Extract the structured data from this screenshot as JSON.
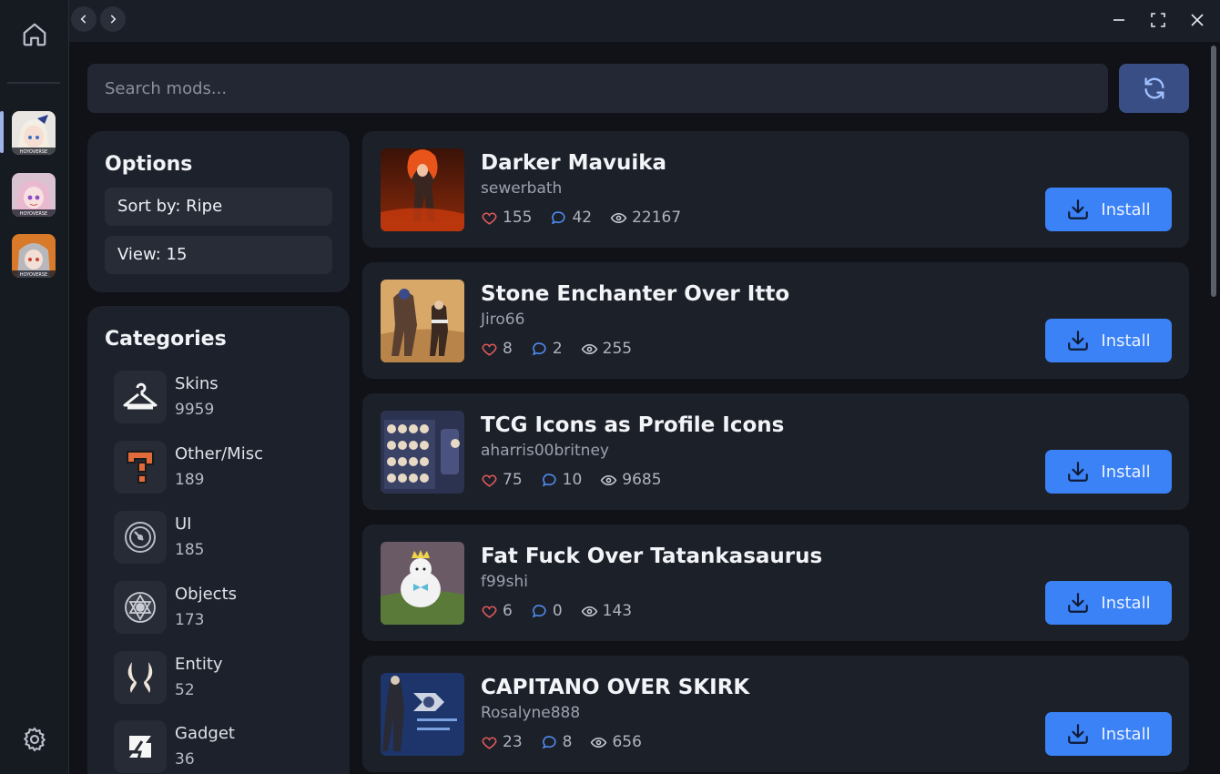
{
  "search": {
    "placeholder": "Search mods..."
  },
  "options": {
    "title": "Options",
    "sort_label": "Sort by: Ripe",
    "view_label": "View: 15"
  },
  "categories": {
    "title": "Categories",
    "items": [
      {
        "name": "Skins",
        "count": "9959",
        "icon": "hanger-icon"
      },
      {
        "name": "Other/Misc",
        "count": "189",
        "icon": "question-block-icon"
      },
      {
        "name": "UI",
        "count": "185",
        "icon": "compass-icon"
      },
      {
        "name": "Objects",
        "count": "173",
        "icon": "emblem-icon"
      },
      {
        "name": "Entity",
        "count": "52",
        "icon": "horns-icon"
      },
      {
        "name": "Gadget",
        "count": "36",
        "icon": "gadget-icon"
      }
    ]
  },
  "mods": [
    {
      "title": "Darker Mavuika",
      "author": "sewerbath",
      "likes": "155",
      "comments": "42",
      "views": "22167",
      "install_label": "Install"
    },
    {
      "title": "Stone Enchanter Over Itto",
      "author": "Jiro66",
      "likes": "8",
      "comments": "2",
      "views": "255",
      "install_label": "Install"
    },
    {
      "title": "TCG Icons as Profile Icons",
      "author": "aharris00britney",
      "likes": "75",
      "comments": "10",
      "views": "9685",
      "install_label": "Install"
    },
    {
      "title": "Fat Fuck Over Tatankasaurus",
      "author": "f99shi",
      "likes": "6",
      "comments": "0",
      "views": "143",
      "install_label": "Install"
    },
    {
      "title": "CAPITANO OVER SKIRK",
      "author": "Rosalyne888",
      "likes": "23",
      "comments": "8",
      "views": "656",
      "install_label": "Install"
    }
  ],
  "colors": {
    "accent": "#3b82f6",
    "like": "#e05a5a",
    "comment": "#4f8cf0",
    "panel": "#1d212b"
  }
}
